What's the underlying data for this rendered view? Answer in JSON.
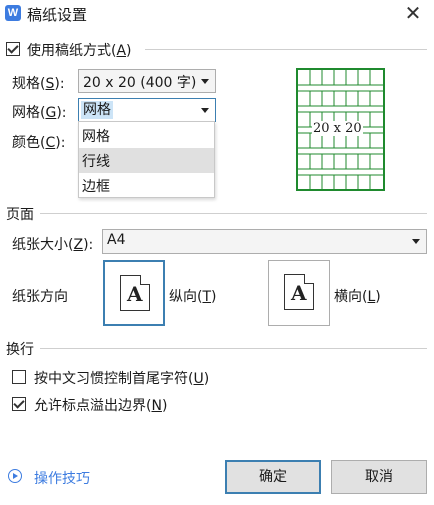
{
  "window": {
    "title": "稿纸设置",
    "app_icon_letter": "W",
    "close_glyph": "✕"
  },
  "use_manuscript": {
    "label": "使用稿纸方式(",
    "key": "A",
    "suffix": ")",
    "checked": true
  },
  "spec": {
    "label": "规格(",
    "key": "S",
    "suffix": "):",
    "value": "20 x 20 (400 字)"
  },
  "grid": {
    "label": "网格(",
    "key": "G",
    "suffix": "):",
    "value": "网格",
    "options": [
      "网格",
      "行线",
      "边框"
    ],
    "highlighted_option": "行线"
  },
  "color": {
    "label": "颜色(",
    "key": "C",
    "suffix": "):"
  },
  "preview": {
    "label": "20 x 20",
    "grid_color": "#1f8a2e"
  },
  "page_section": {
    "title": "页面"
  },
  "paper_size": {
    "label": "纸张大小(",
    "key": "Z",
    "suffix": "):",
    "value": "A4"
  },
  "orientation": {
    "label": "纸张方向",
    "portrait": {
      "label": "纵向(",
      "key": "T",
      "suffix": ")",
      "glyph": "A",
      "selected": true
    },
    "landscape": {
      "label": "横向(",
      "key": "L",
      "suffix": ")",
      "glyph": "A",
      "selected": false
    }
  },
  "wrap_section": {
    "title": "换行",
    "option1": {
      "label": "按中文习惯控制首尾字符(",
      "key": "U",
      "suffix": ")",
      "checked": false
    },
    "option2": {
      "label": "允许标点溢出边界(",
      "key": "N",
      "suffix": ")",
      "checked": true
    }
  },
  "footer": {
    "tips_label": "操作技巧",
    "ok_label": "确定",
    "cancel_label": "取消"
  },
  "colors": {
    "accent": "#3c7fb1",
    "link": "#3d7ce0",
    "grid": "#1f8a2e"
  }
}
